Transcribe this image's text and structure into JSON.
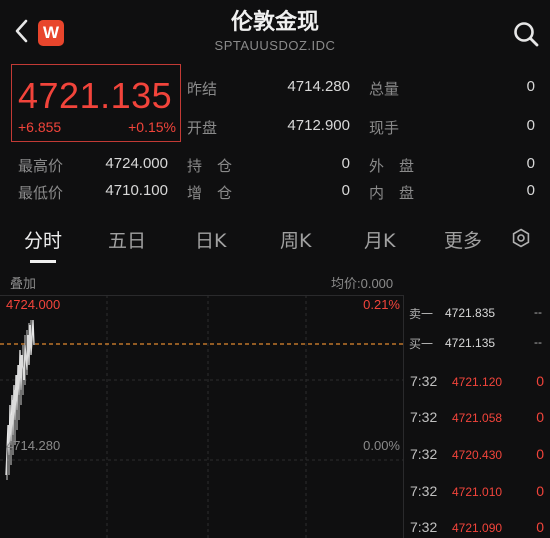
{
  "header": {
    "badge": "W",
    "title": "伦敦金现",
    "subtitle": "SPTAUUSDOZ.IDC"
  },
  "quote": {
    "price": "4721.135",
    "change": "+6.855",
    "change_pct": "+0.15%",
    "accent_color": "#f2443b"
  },
  "stats": {
    "prev_close_label": "昨结",
    "prev_close": "4714.280",
    "total_vol_label": "总量",
    "total_vol": "0",
    "open_label": "开盘",
    "open": "4712.900",
    "current_vol_label": "现手",
    "current_vol": "0",
    "high_label": "最高价",
    "high": "4724.000",
    "open_interest_label": "持　仓",
    "open_interest": "0",
    "outer_label": "外　盘",
    "outer": "0",
    "low_label": "最低价",
    "low": "4710.100",
    "oi_change_label": "增　仓",
    "oi_change": "0",
    "inner_label": "内　盘",
    "inner": "0"
  },
  "tabs": [
    {
      "label": "分时"
    },
    {
      "label": "五日"
    },
    {
      "label": "日K"
    },
    {
      "label": "周K"
    },
    {
      "label": "月K"
    },
    {
      "label": "更多"
    }
  ],
  "chart": {
    "overlay_label": "叠加",
    "avg_label": "均价:0.000",
    "top_price": "4724.000",
    "top_pct": "0.21%",
    "base_price": "4714.280",
    "base_pct": "0.00%"
  },
  "order_book": [
    {
      "label": "卖一",
      "price": "4721.835",
      "qty": "--"
    },
    {
      "label": "买一",
      "price": "4721.135",
      "qty": "--"
    }
  ],
  "ticks": [
    {
      "time": "7:32",
      "price": "4721.120",
      "qty": "0"
    },
    {
      "time": "7:32",
      "price": "4721.058",
      "qty": "0"
    },
    {
      "time": "7:32",
      "price": "4720.430",
      "qty": "0"
    },
    {
      "time": "7:32",
      "price": "4721.010",
      "qty": "0"
    },
    {
      "time": "7:32",
      "price": "4721.090",
      "qty": "0"
    }
  ]
}
